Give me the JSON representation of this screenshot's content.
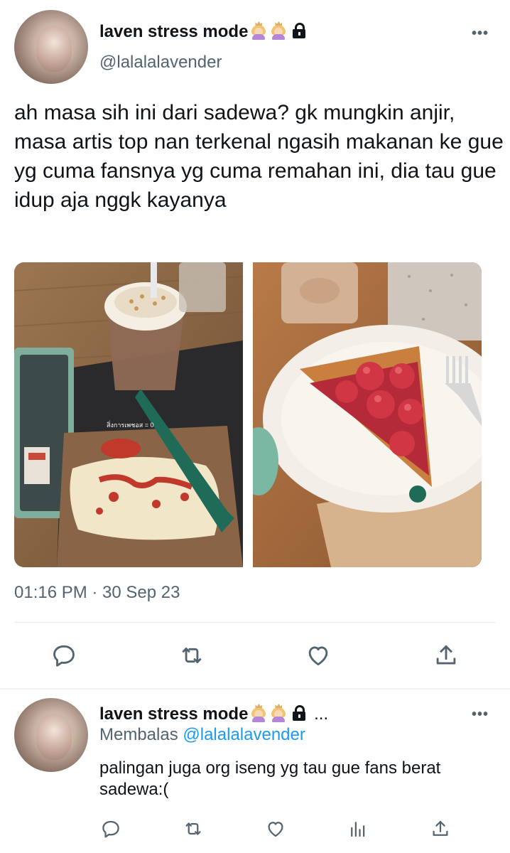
{
  "tweet": {
    "author_name": "laven stress mode",
    "author_handle": "@lalalalavender",
    "text": "ah masa sih ini dari sadewa? gk mungkin anjir, masa artis top nan terkenal ngasih makanan ke gue yg cuma fansnya yg cuma remahan ini, dia tau gue idup aja nggk kayanya",
    "timestamp": "01:16 PM · 30 Sep 23",
    "more_label": "•••"
  },
  "reply": {
    "author_name": "laven stress mode",
    "ellipsis": "...",
    "replying_prefix": "Membalas",
    "replying_to": "@lalalalavender",
    "text": "palingan juga org iseng yg tau gue fans berat sadewa:(",
    "more_label": "•••"
  },
  "icons": {
    "reply": "reply-icon",
    "retweet": "retweet-icon",
    "like": "like-icon",
    "share": "share-icon",
    "views": "views-icon",
    "lock": "lock-icon",
    "emoji": "person-gesturing-no-icon"
  },
  "colors": {
    "text": "#0f1419",
    "secondary": "#536471",
    "link": "#1d9bf0",
    "divider": "#e6ecf0"
  }
}
